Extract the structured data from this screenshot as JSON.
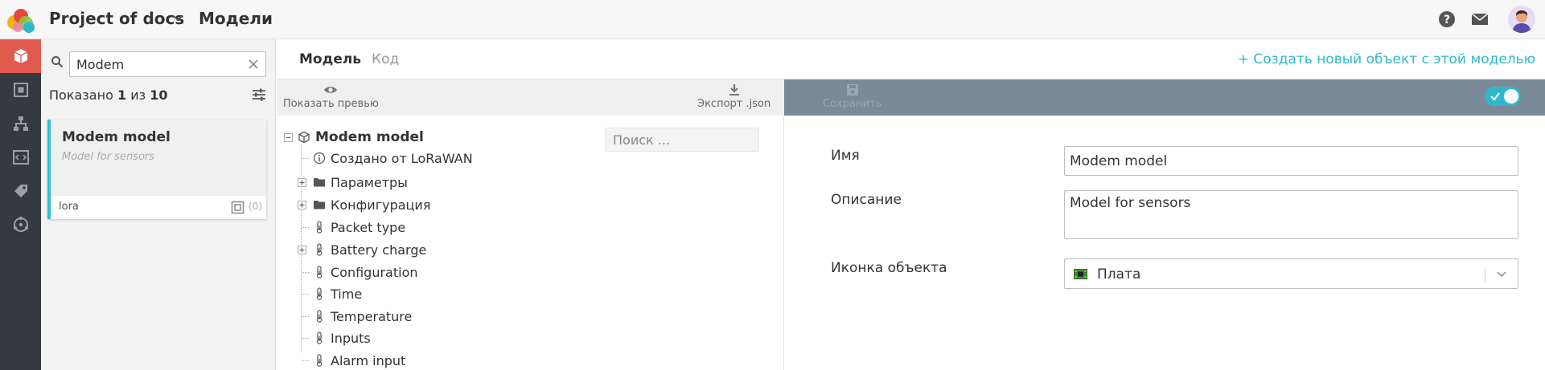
{
  "header": {
    "project_title": "Project of docs",
    "page_title": "Модели"
  },
  "rail": {
    "items": [
      {
        "icon": "cube-icon",
        "active": true
      },
      {
        "icon": "objects-icon",
        "active": false
      },
      {
        "icon": "hierarchy-icon",
        "active": false
      },
      {
        "icon": "code-icon",
        "active": false
      },
      {
        "icon": "tag-icon",
        "active": false
      },
      {
        "icon": "network-icon",
        "active": false
      }
    ]
  },
  "search": {
    "value": "Modem",
    "shown_prefix": "Показано",
    "shown_count": "1",
    "shown_of": "из",
    "shown_total": "10"
  },
  "card": {
    "title": "Modem model",
    "description": "Model for sensors",
    "tag": "lora",
    "count": "(0)"
  },
  "tabs": {
    "model": "Модель",
    "code": "Код",
    "create_link": "+ Создать новый объект с этой моделью"
  },
  "tree_toolbar": {
    "preview": "Показать превью",
    "export": "Экспорт .json"
  },
  "right_toolbar": {
    "save": "Сохранить"
  },
  "tree": {
    "search_placeholder": "Поиск ...",
    "root": "Modem model",
    "nodes": [
      {
        "label": "Создано от LoRaWAN",
        "icon": "info-icon"
      },
      {
        "label": "Параметры",
        "icon": "folder-icon"
      },
      {
        "label": "Конфигурация",
        "icon": "folder-icon"
      },
      {
        "label": "Packet type",
        "icon": "thermometer-icon"
      },
      {
        "label": "Battery charge",
        "icon": "thermometer-icon"
      },
      {
        "label": "Configuration",
        "icon": "thermometer-icon"
      },
      {
        "label": "Time",
        "icon": "thermometer-icon"
      },
      {
        "label": "Temperature",
        "icon": "thermometer-icon"
      },
      {
        "label": "Inputs",
        "icon": "thermometer-icon"
      },
      {
        "label": "Alarm input",
        "icon": "thermometer-icon"
      }
    ]
  },
  "form": {
    "name_label": "Имя",
    "name_value": "Modem model",
    "desc_label": "Описание",
    "desc_value": "Model for sensors",
    "icon_label": "Иконка объекта",
    "icon_value": "Плата"
  },
  "colors": {
    "accent": "#2fb8cc",
    "rail_active": "#e05a4f",
    "rail_bg": "#36393f",
    "right_toolbar": "#7a8a99"
  }
}
